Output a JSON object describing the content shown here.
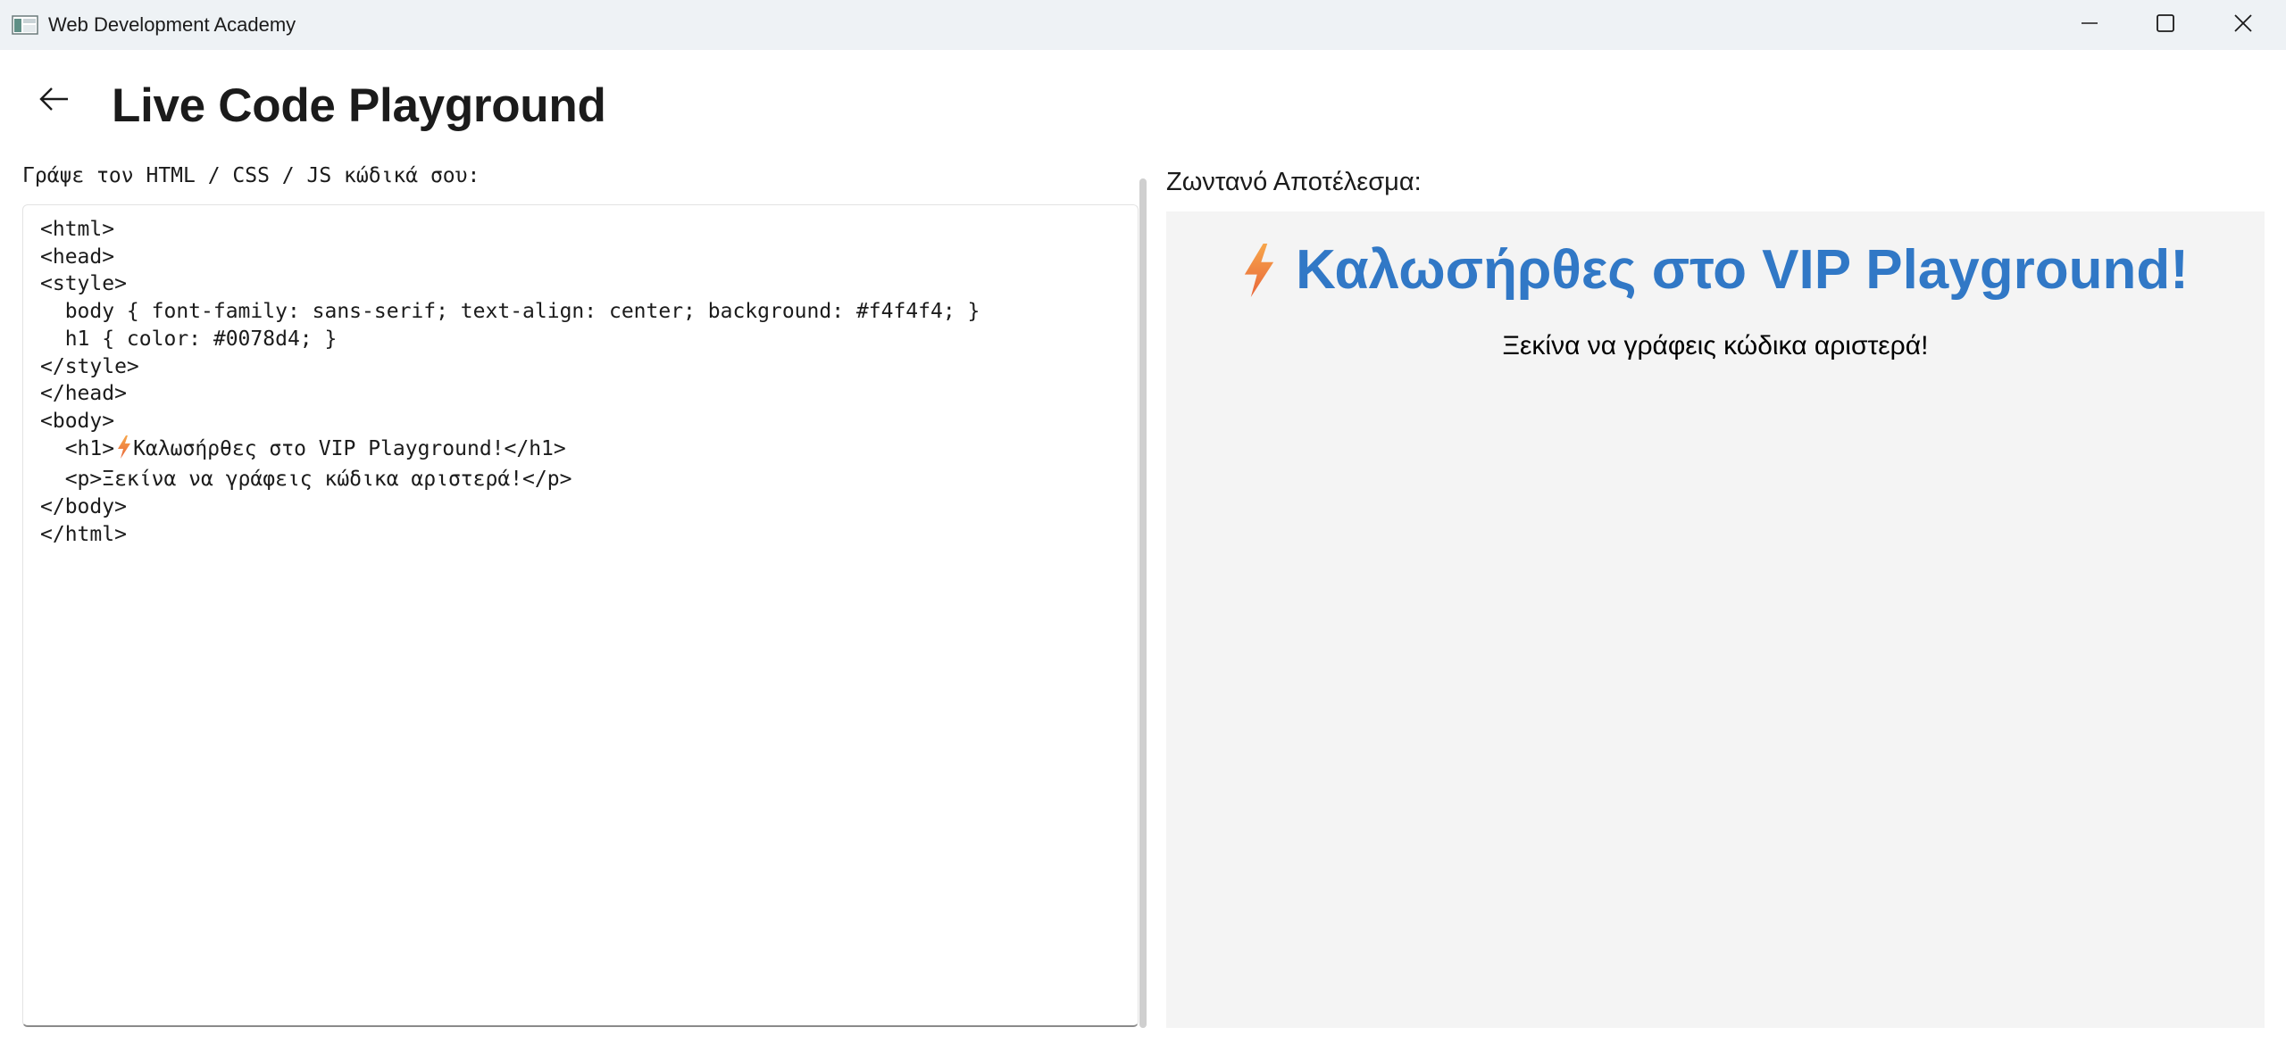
{
  "window": {
    "title": "Web Development Academy",
    "icons": {
      "app": "app-window-icon",
      "minimize": "minimize-icon",
      "maximize": "maximize-icon",
      "close": "close-icon"
    }
  },
  "header": {
    "back_icon": "arrow-left-icon",
    "title": "Live Code Playground"
  },
  "editor": {
    "label": "Γράψε τον HTML / CSS / JS κώδικά σου:",
    "lines": [
      "<html>",
      "<head>",
      "<style>",
      "  body { font-family: sans-serif; text-align: center; background: #f4f4f4; }",
      "  h1 { color: #0078d4; }",
      "</style>",
      "</head>",
      "<body>",
      "  <h1>",
      "Καλωσήρθες στο VIP Playground!</h1>",
      "  <p>Ξεκίνα να γράφεις κώδικα αριστερά!</p>",
      "</body>",
      "</html>"
    ]
  },
  "preview": {
    "label": "Ζωντανό Αποτέλεσμα:",
    "heading": "Καλωσήρθες στο VIP Playground!",
    "paragraph": "Ξεκίνα να γράφεις κώδικα αριστερά!",
    "heading_color": "#3178c6",
    "background": "#f4f4f4",
    "bolt_icon": "lightning-bolt-icon"
  }
}
